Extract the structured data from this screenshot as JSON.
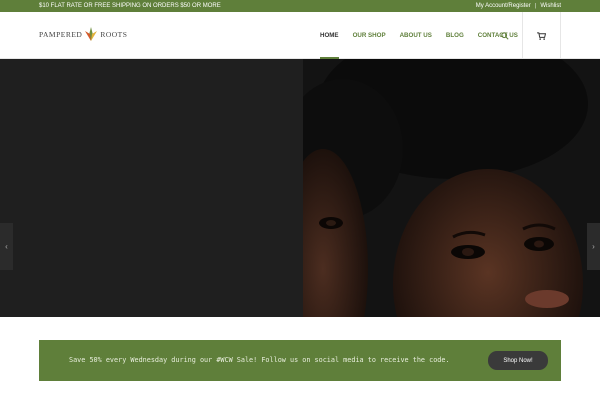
{
  "topbar": {
    "promo": "$10 FLAT RATE OR FREE SHIPPING ON ORDERS $50 OR MORE",
    "account_link": "My Account/Register",
    "separator": "|",
    "wishlist_link": "Wishlist"
  },
  "brand": {
    "name": "PAMPERED",
    "name2": "ROOTS"
  },
  "nav": {
    "items": [
      {
        "label": "HOME"
      },
      {
        "label": "OUR SHOP"
      },
      {
        "label": "ABOUT US"
      },
      {
        "label": "BLOG"
      },
      {
        "label": "CONTACT US"
      }
    ]
  },
  "icons": {
    "search": "search-icon",
    "cart": "cart-icon",
    "prev": "chevron-left-icon",
    "next": "chevron-right-icon"
  },
  "slider": {
    "prev_glyph": "‹",
    "next_glyph": "›"
  },
  "promo_banner": {
    "text": "Save 50% every Wednesday during our #WCW Sale! Follow us on social media to receive the code.",
    "button": "Shop Now!"
  },
  "colors": {
    "brand_green": "#5f7f3a",
    "button_dark": "#3a3a3a"
  }
}
